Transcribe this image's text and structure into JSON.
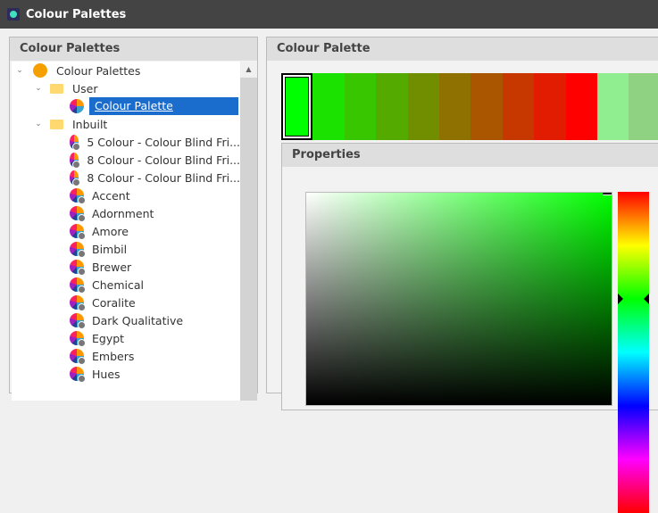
{
  "window": {
    "title": "Colour Palettes"
  },
  "left_panel": {
    "title": "Colour Palettes",
    "tree": {
      "root": "Colour Palettes",
      "user_folder": "User",
      "user_items": [
        "Colour Palette"
      ],
      "inbuilt_folder": "Inbuilt",
      "inbuilt_items": [
        "5 Colour - Colour Blind Fri...",
        "8 Colour - Colour Blind Fri...",
        "8 Colour - Colour Blind Fri...",
        "Accent",
        "Adornment",
        "Amore",
        "Bimbil",
        "Brewer",
        "Chemical",
        "Coralite",
        "Dark Qualitative",
        "Egypt",
        "Embers",
        "Hues"
      ]
    }
  },
  "right_panel": {
    "title": "Colour Palette",
    "swatches": [
      "#00ff00",
      "#1ce200",
      "#38c600",
      "#55aa00",
      "#718e00",
      "#8e7100",
      "#aa5500",
      "#c63800",
      "#e21c00",
      "#ff0000",
      "#90ee90",
      "#8ed282"
    ],
    "selected_swatch": 0,
    "properties": {
      "title": "Properties",
      "selected_color": "#00ff00",
      "hue_degrees": 120
    }
  }
}
